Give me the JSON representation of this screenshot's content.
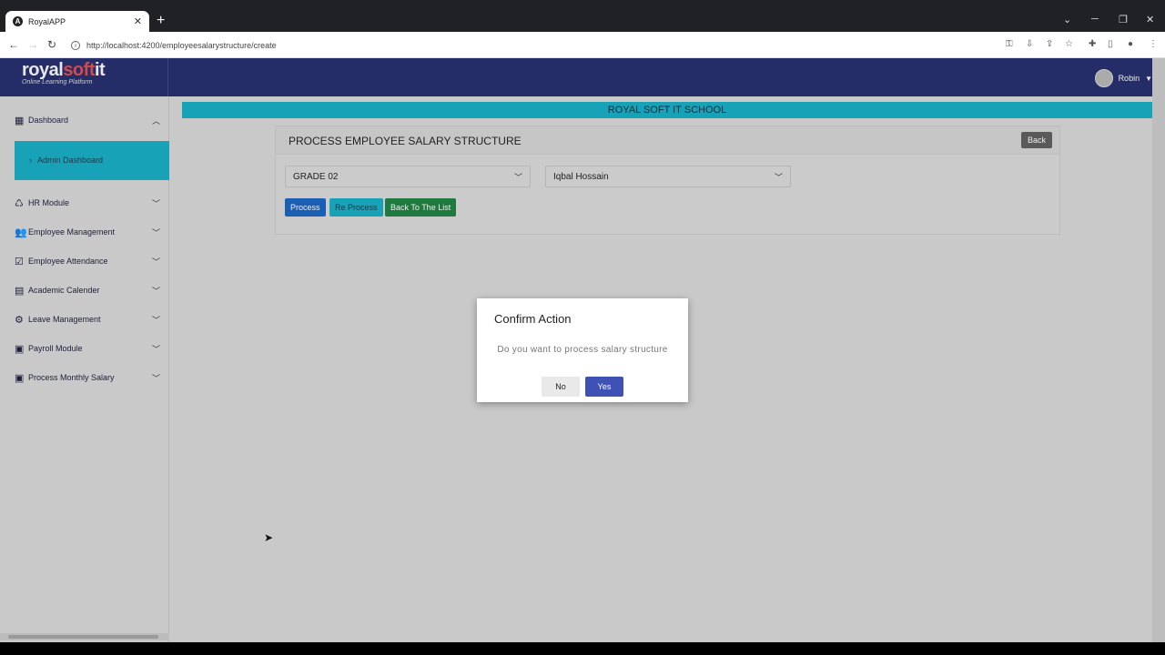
{
  "browser": {
    "tab_title": "RoyalAPP",
    "tab_close": "✕",
    "new_tab": "+",
    "url": "http://localhost:4200/employeesalarystructure/create",
    "controls": {
      "dropdown": "⌄",
      "minimize": "─",
      "restore": "❐",
      "close": "✕"
    }
  },
  "header": {
    "logo_royal": "royal",
    "logo_soft": "soft",
    "logo_it": "it",
    "logo_tagline": "Online Learning Platform",
    "user_name": "Robin"
  },
  "sidebar": {
    "dashboard": "Dashboard",
    "admin_dashboard": "Admin Dashboard",
    "items": [
      {
        "label": "HR Module",
        "icon": "hr-icon"
      },
      {
        "label": "Employee Management",
        "icon": "people-icon"
      },
      {
        "label": "Employee Attendance",
        "icon": "checkbox-icon"
      },
      {
        "label": "Academic Calender",
        "icon": "calendar-icon"
      },
      {
        "label": "Leave Management",
        "icon": "gear-icon"
      },
      {
        "label": "Payroll Module",
        "icon": "money-icon"
      },
      {
        "label": "Process Monthly Salary",
        "icon": "money-icon"
      }
    ]
  },
  "main": {
    "school_name": "ROYAL SOFT IT SCHOOL",
    "card_title": "PROCESS EMPLOYEE SALARY STRUCTURE",
    "back_label": "Back",
    "grade_value": "GRADE 02",
    "employee_value": "Iqbal Hossain",
    "process_label": "Process",
    "reprocess_label": "Re Process",
    "back_to_list_label": "Back To The List"
  },
  "modal": {
    "title": "Confirm Action",
    "message": "Do you want to process salary structure",
    "no_label": "No",
    "yes_label": "Yes"
  },
  "colors": {
    "header_bg": "#252d68",
    "accent_teal": "#17a2b8",
    "primary_blue": "#1a5fb4",
    "success_green": "#1f7a3f",
    "modal_yes": "#3f51b5"
  }
}
